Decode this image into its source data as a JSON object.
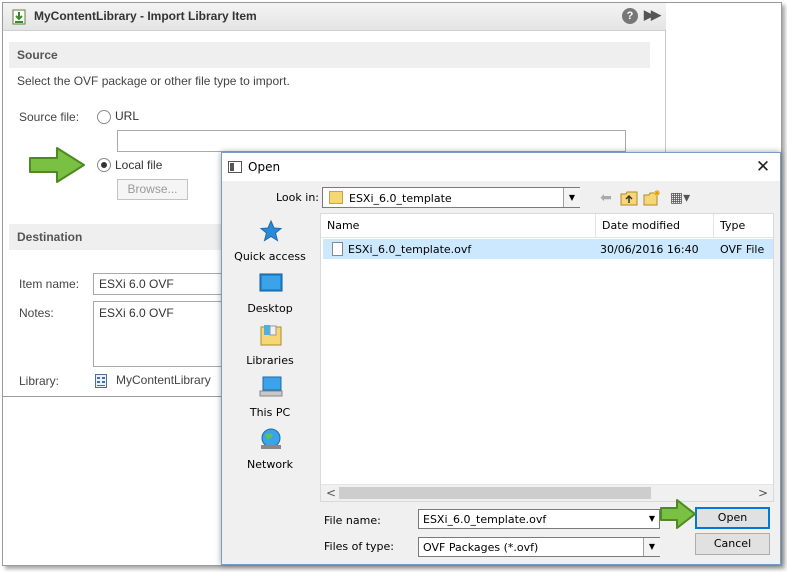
{
  "import_dialog": {
    "title": "MyContentLibrary - Import Library Item",
    "help_glyph": "?",
    "expand_glyph": "▶▶",
    "source": {
      "heading": "Source",
      "description": "Select the OVF package or other file type to import.",
      "source_file_label": "Source file:",
      "url_option_label": "URL",
      "url_value": "",
      "local_file_option_label": "Local file",
      "selected_option": "Local file",
      "browse_label": "Browse..."
    },
    "destination": {
      "heading": "Destination",
      "item_name_label": "Item name:",
      "item_name_value": "ESXi 6.0 OVF",
      "notes_label": "Notes:",
      "notes_value": "ESXi 6.0 OVF",
      "library_label": "Library:",
      "library_value": "MyContentLibrary"
    }
  },
  "open_dialog": {
    "title": "Open",
    "close_glyph": "✕",
    "look_in_label": "Look in:",
    "look_in_value": "ESXi_6.0_template",
    "toolbar": {
      "back_glyph": "⬅",
      "up_glyph": "⮤",
      "new_folder_glyph": "✱",
      "views_glyph": "▦▾"
    },
    "places": [
      {
        "label": "Quick access",
        "icon": "star-icon"
      },
      {
        "label": "Desktop",
        "icon": "desktop-icon"
      },
      {
        "label": "Libraries",
        "icon": "libraries-icon"
      },
      {
        "label": "This PC",
        "icon": "computer-icon"
      },
      {
        "label": "Network",
        "icon": "network-icon"
      }
    ],
    "columns": [
      "Name",
      "Date modified",
      "Type"
    ],
    "sort_caret": "^",
    "files": [
      {
        "name": "ESXi_6.0_template.ovf",
        "date_modified": "30/06/2016 16:40",
        "type": "OVF File",
        "selected": true
      }
    ],
    "scroll_left_glyph": "<",
    "scroll_right_glyph": ">",
    "file_name_label": "File name:",
    "file_name_value": "ESXi_6.0_template.ovf",
    "files_of_type_label": "Files of type:",
    "files_of_type_value": "OVF Packages (*.ovf)",
    "dropdown_glyph": "▼",
    "open_label": "Open",
    "cancel_label": "Cancel"
  },
  "colors": {
    "accent_green": "#7ac143",
    "selection_blue": "#cce8ff",
    "default_button_border": "#0078d7"
  }
}
